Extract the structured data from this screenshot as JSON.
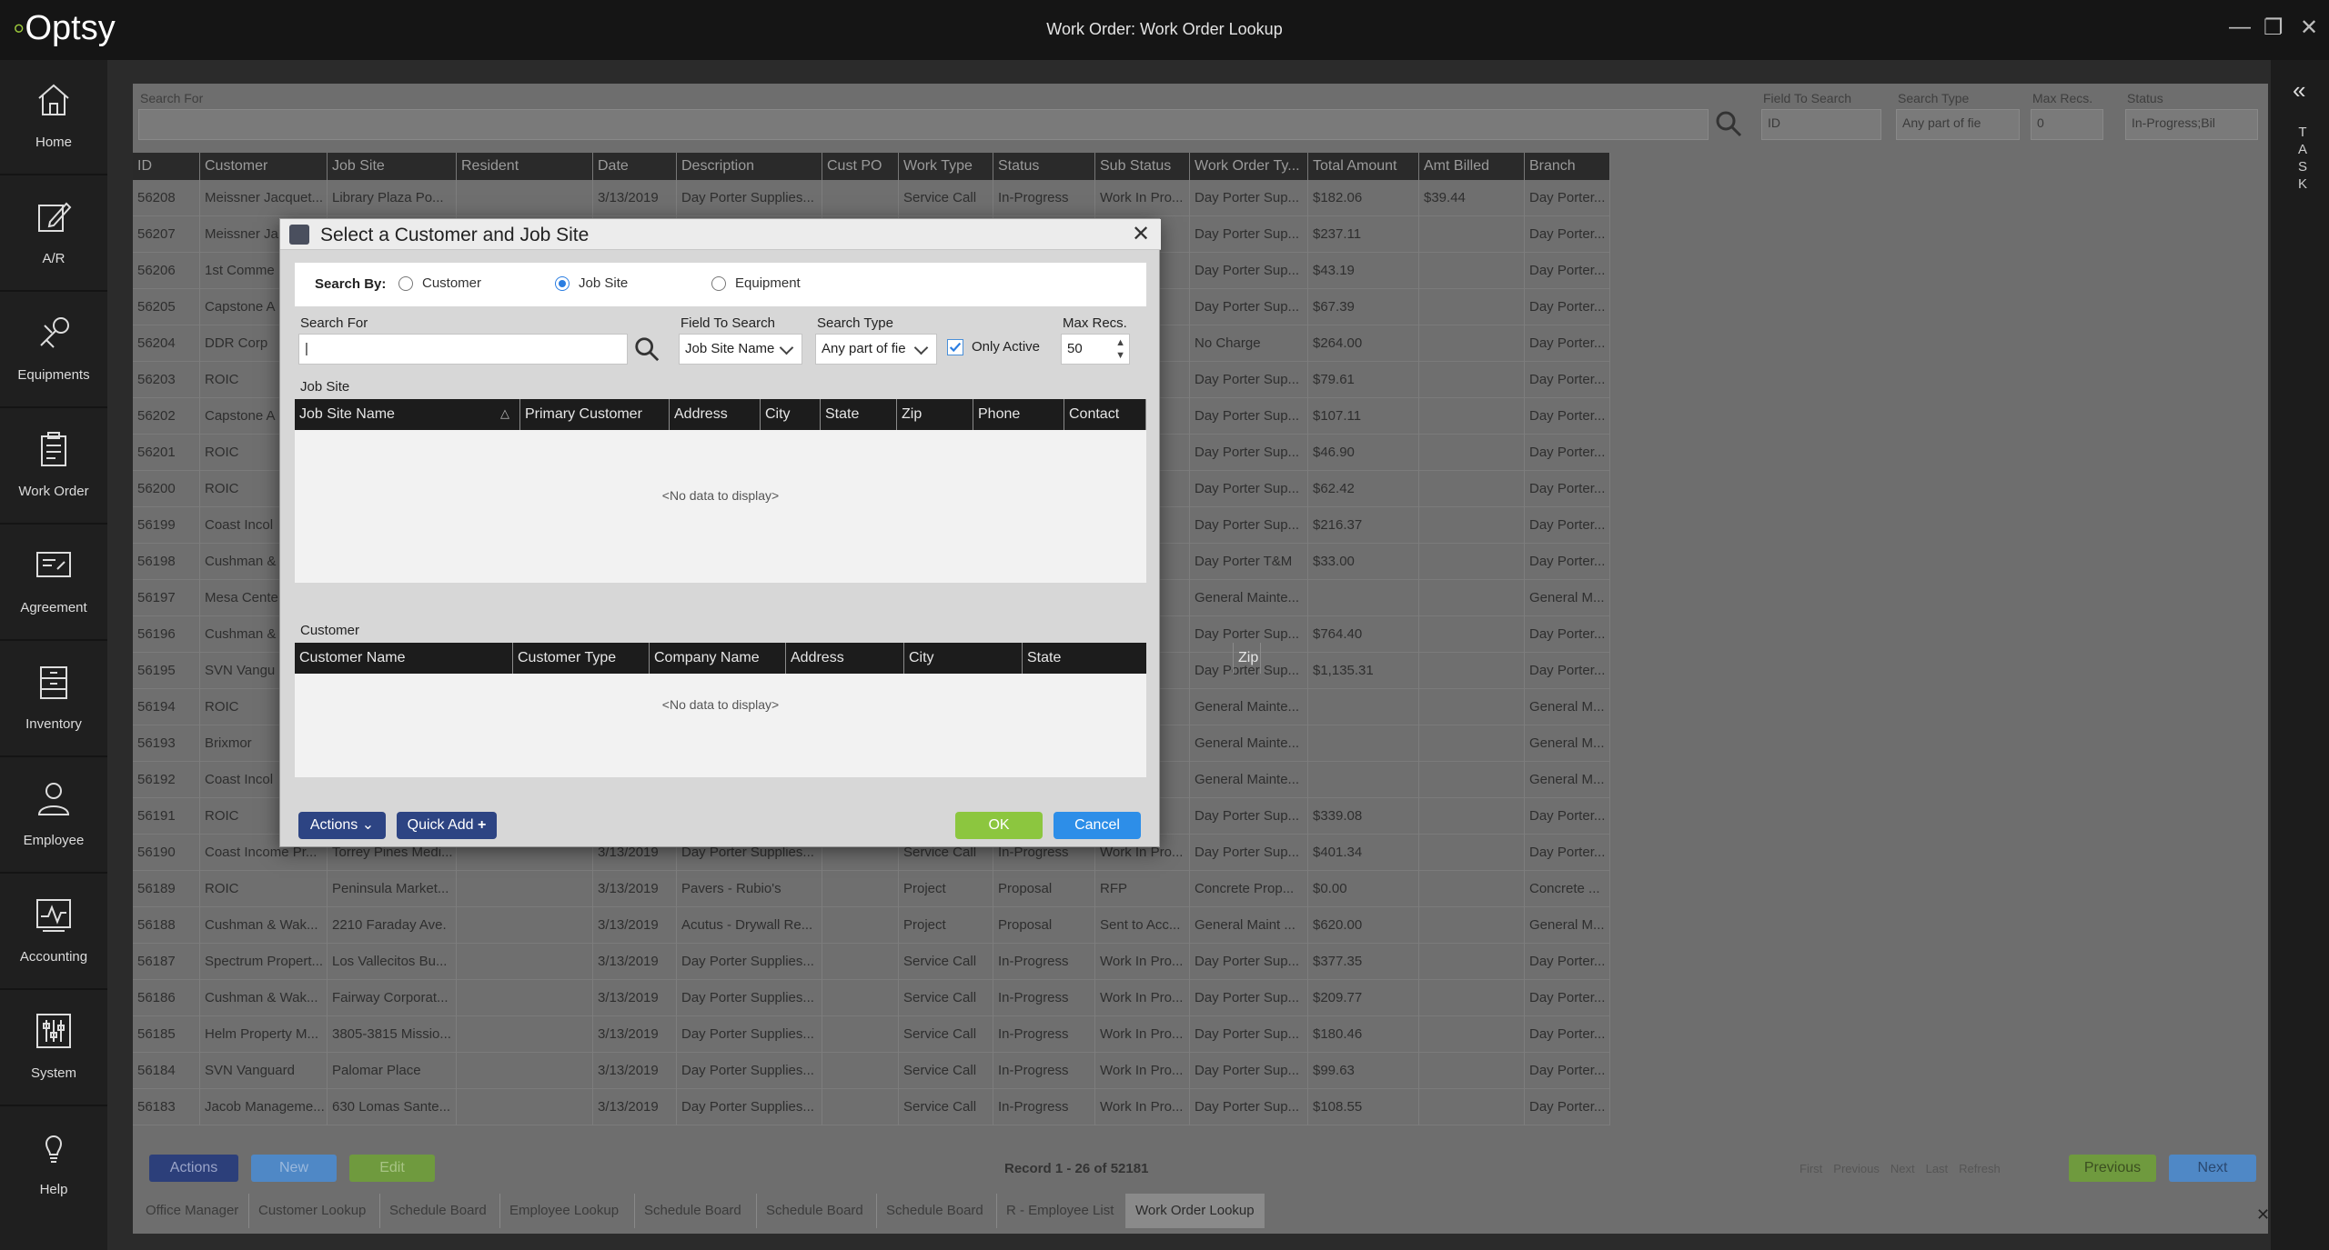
{
  "app": {
    "logo": "Optsy",
    "window_title": "Work Order: Work Order Lookup",
    "controls": {
      "minimize": "—",
      "restore": "❐",
      "close": "✕"
    }
  },
  "sidebar": {
    "items": [
      {
        "label": "Home",
        "icon": "home-icon"
      },
      {
        "label": "A/R",
        "icon": "edit-icon"
      },
      {
        "label": "Equipments",
        "icon": "wrench-icon"
      },
      {
        "label": "Work Order",
        "icon": "clipboard-icon"
      },
      {
        "label": "Agreement",
        "icon": "agreement-icon"
      },
      {
        "label": "Inventory",
        "icon": "inventory-icon"
      },
      {
        "label": "Employee",
        "icon": "user-icon"
      },
      {
        "label": "Accounting",
        "icon": "chart-icon"
      },
      {
        "label": "System",
        "icon": "sliders-icon"
      },
      {
        "label": "Help",
        "icon": "bulb-icon"
      }
    ]
  },
  "task_strip": {
    "toggle": "«",
    "letters": [
      "T",
      "A",
      "S",
      "K"
    ]
  },
  "lookup": {
    "search_for_label": "Search For",
    "field_to_search_label": "Field To Search",
    "field_to_search_value": "ID",
    "search_type_label": "Search Type",
    "search_type_value": "Any part of fie",
    "max_recs_label": "Max Recs.",
    "max_recs_value": "0",
    "status_label": "Status",
    "status_value": "In-Progress;Bil"
  },
  "grid": {
    "columns": [
      "ID",
      "Customer",
      "Job Site",
      "Resident",
      "Date",
      "Description",
      "Cust PO",
      "Work Type",
      "Status",
      "Sub Status",
      "Work Order Ty...",
      "Total Amount",
      "Amt Billed",
      "Branch"
    ],
    "rows": [
      [
        "56208",
        "Meissner Jacquet...",
        "Library Plaza Po...",
        "",
        "3/13/2019",
        "Day Porter Supplies...",
        "",
        "Service Call",
        "In-Progress",
        "Work In Pro...",
        "Day Porter Sup...",
        "$182.06",
        "$39.44",
        "Day Porter..."
      ],
      [
        "56207",
        "Meissner Ja",
        "",
        "",
        "",
        "",
        "",
        "",
        "",
        "ro...",
        "Day Porter Sup...",
        "$237.11",
        "",
        "Day Porter..."
      ],
      [
        "56206",
        "1st Comme",
        "",
        "",
        "",
        "",
        "",
        "",
        "",
        "ro...",
        "Day Porter Sup...",
        "$43.19",
        "",
        "Day Porter..."
      ],
      [
        "56205",
        "Capstone A",
        "",
        "",
        "",
        "",
        "",
        "",
        "",
        "ro...",
        "Day Porter Sup...",
        "$67.39",
        "",
        "Day Porter..."
      ],
      [
        "56204",
        "DDR Corp",
        "",
        "",
        "",
        "",
        "",
        "",
        "",
        "ro...",
        "No Charge",
        "$264.00",
        "",
        "Day Porter..."
      ],
      [
        "56203",
        "ROIC",
        "",
        "",
        "",
        "",
        "",
        "",
        "",
        "ro...",
        "Day Porter Sup...",
        "$79.61",
        "",
        "Day Porter..."
      ],
      [
        "56202",
        "Capstone A",
        "",
        "",
        "",
        "",
        "",
        "",
        "",
        "ro...",
        "Day Porter Sup...",
        "$107.11",
        "",
        "Day Porter..."
      ],
      [
        "56201",
        "ROIC",
        "",
        "",
        "",
        "",
        "",
        "",
        "",
        "ro...",
        "Day Porter Sup...",
        "$46.90",
        "",
        "Day Porter..."
      ],
      [
        "56200",
        "ROIC",
        "",
        "",
        "",
        "",
        "",
        "",
        "",
        "ro...",
        "Day Porter Sup...",
        "$62.42",
        "",
        "Day Porter..."
      ],
      [
        "56199",
        "Coast Incol",
        "",
        "",
        "",
        "",
        "",
        "",
        "",
        "ro...",
        "Day Porter Sup...",
        "$216.37",
        "",
        "Day Porter..."
      ],
      [
        "56198",
        "Cushman &",
        "",
        "",
        "",
        "",
        "",
        "",
        "",
        "ro...",
        "Day Porter T&M",
        "$33.00",
        "",
        "Day Porter..."
      ],
      [
        "56197",
        "Mesa Cente",
        "",
        "",
        "",
        "",
        "",
        "",
        "",
        "ro...",
        "General Mainte...",
        "",
        "",
        "General M..."
      ],
      [
        "56196",
        "Cushman &",
        "",
        "",
        "",
        "",
        "",
        "",
        "",
        "ro...",
        "Day Porter Sup...",
        "$764.40",
        "",
        "Day Porter..."
      ],
      [
        "56195",
        "SVN Vangu",
        "",
        "",
        "",
        "",
        "",
        "",
        "",
        "ro...",
        "Day Porter Sup...",
        "$1,135.31",
        "",
        "Day Porter..."
      ],
      [
        "56194",
        "ROIC",
        "",
        "",
        "",
        "",
        "",
        "",
        "",
        "ro...",
        "General Mainte...",
        "",
        "",
        "General M..."
      ],
      [
        "56193",
        "Brixmor",
        "",
        "",
        "",
        "",
        "",
        "",
        "",
        "ro...",
        "General Mainte...",
        "",
        "",
        "General M..."
      ],
      [
        "56192",
        "Coast Incol",
        "",
        "",
        "",
        "",
        "",
        "",
        "",
        "ro...",
        "General Mainte...",
        "",
        "",
        "General M..."
      ],
      [
        "56191",
        "ROIC",
        "",
        "",
        "",
        "",
        "",
        "",
        "",
        "ro...",
        "Day Porter Sup...",
        "$339.08",
        "",
        "Day Porter..."
      ],
      [
        "56190",
        "Coast Income Pr...",
        "Torrey Pines Medi...",
        "",
        "3/13/2019",
        "Day Porter Supplies...",
        "",
        "Service Call",
        "In-Progress",
        "Work In Pro...",
        "Day Porter Sup...",
        "$401.34",
        "",
        "Day Porter..."
      ],
      [
        "56189",
        "ROIC",
        "Peninsula Market...",
        "",
        "3/13/2019",
        "Pavers - Rubio's",
        "",
        "Project",
        "Proposal",
        "RFP",
        "Concrete Prop...",
        "$0.00",
        "",
        "Concrete ..."
      ],
      [
        "56188",
        "Cushman & Wak...",
        "2210 Faraday Ave.",
        "",
        "3/13/2019",
        "Acutus - Drywall Re...",
        "",
        "Project",
        "Proposal",
        "Sent to Acc...",
        "General Maint ...",
        "$620.00",
        "",
        "General M..."
      ],
      [
        "56187",
        "Spectrum Propert...",
        "Los Vallecitos Bu...",
        "",
        "3/13/2019",
        "Day Porter Supplies...",
        "",
        "Service Call",
        "In-Progress",
        "Work In Pro...",
        "Day Porter Sup...",
        "$377.35",
        "",
        "Day Porter..."
      ],
      [
        "56186",
        "Cushman & Wak...",
        "Fairway Corporat...",
        "",
        "3/13/2019",
        "Day Porter Supplies...",
        "",
        "Service Call",
        "In-Progress",
        "Work In Pro...",
        "Day Porter Sup...",
        "$209.77",
        "",
        "Day Porter..."
      ],
      [
        "56185",
        "Helm Property M...",
        "3805-3815 Missio...",
        "",
        "3/13/2019",
        "Day Porter Supplies...",
        "",
        "Service Call",
        "In-Progress",
        "Work In Pro...",
        "Day Porter Sup...",
        "$180.46",
        "",
        "Day Porter..."
      ],
      [
        "56184",
        "SVN Vanguard",
        "Palomar Place",
        "",
        "3/13/2019",
        "Day Porter Supplies...",
        "",
        "Service Call",
        "In-Progress",
        "Work In Pro...",
        "Day Porter Sup...",
        "$99.63",
        "",
        "Day Porter..."
      ],
      [
        "56183",
        "Jacob Manageme...",
        "630 Lomas Sante...",
        "",
        "3/13/2019",
        "Day Porter Supplies...",
        "",
        "Service Call",
        "In-Progress",
        "Work In Pro...",
        "Day Porter Sup...",
        "$108.55",
        "",
        "Day Porter..."
      ]
    ]
  },
  "bottom": {
    "actions": "Actions",
    "new": "New",
    "edit": "Edit",
    "record_info": "Record 1 - 26 of 52181",
    "pager": [
      "First",
      "Previous",
      "Next",
      "Last",
      "Refresh"
    ],
    "previous": "Previous",
    "next": "Next",
    "tabs": [
      "Office Manager",
      "Customer Lookup",
      "Schedule Board",
      "Employee Lookup",
      "Schedule Board",
      "Schedule Board",
      "Schedule Board",
      "R - Employee List",
      "Work Order Lookup"
    ],
    "close": "✕"
  },
  "dialog": {
    "title": "Select a Customer and Job Site",
    "close": "✕",
    "search_by_label": "Search By:",
    "radios": [
      {
        "label": "Customer",
        "selected": false
      },
      {
        "label": "Job Site",
        "selected": true
      },
      {
        "label": "Equipment",
        "selected": false
      }
    ],
    "search_for_label": "Search For",
    "search_for_value": "|",
    "field_to_search_label": "Field To Search",
    "field_to_search_value": "Job Site Name",
    "search_type_label": "Search Type",
    "search_type_value": "Any part of fie",
    "only_active_label": "Only Active",
    "max_recs_label": "Max Recs.",
    "max_recs_value": "50",
    "jobsite_section": "Job Site",
    "jobsite_columns": [
      "Job Site Name",
      "Primary Customer",
      "Address",
      "City",
      "State",
      "Zip",
      "Phone",
      "Contact"
    ],
    "customer_section": "Customer",
    "customer_columns": [
      "Customer Name",
      "Customer Type",
      "Company Name",
      "Address",
      "City",
      "State",
      "Zip"
    ],
    "no_data": "<No data to display>",
    "actions": "Actions",
    "quick_add": "Quick Add",
    "ok": "OK",
    "cancel": "Cancel"
  }
}
